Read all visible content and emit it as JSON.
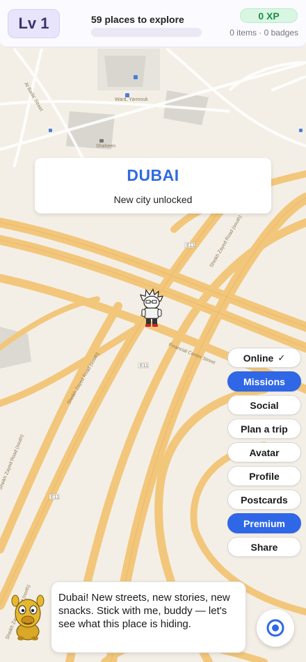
{
  "header": {
    "level": "Lv 1",
    "places": "59 places to explore",
    "progress_fraction": 0,
    "xp": "0 XP",
    "counts": "0 items · 0 badges"
  },
  "city_card": {
    "name": "DUBAI",
    "subtitle": "New city unlocked"
  },
  "map": {
    "labels": {
      "al_bada_street": "Al Bada' Street",
      "ward_yarmouk": "Ward, Yarmouk",
      "sheikh_zayed_road_south_1": "Sheikh Zayed Road (south)",
      "sheikh_zayed_road_south_2": "Sheikh Zayed Road (south)",
      "sheikh_zayed_road_north": "Sheikh Zayed Road (north)",
      "financial_center_street": "Financial Center Street",
      "e11_1": "E11",
      "e11_2": "E11",
      "e11_3": "E11",
      "poi_shaheen": "Shaheen"
    }
  },
  "menu": {
    "online": "Online",
    "online_check": "✓",
    "missions": "Missions",
    "social": "Social",
    "plan_trip": "Plan a trip",
    "avatar": "Avatar",
    "profile": "Profile",
    "postcards": "Postcards",
    "premium": "Premium",
    "share": "Share"
  },
  "speech": {
    "text": "Dubai! New streets, new stories, new snacks. Stick with me, buddy — let's see what this place is hiding."
  },
  "icons": {
    "locate": "locate-target-icon",
    "mascot": "camel-mascot-icon",
    "avatar": "player-avatar-icon"
  },
  "colors": {
    "accent": "#2f67e6",
    "xp_green": "#1f8f4a",
    "road": "#f2c77c"
  }
}
